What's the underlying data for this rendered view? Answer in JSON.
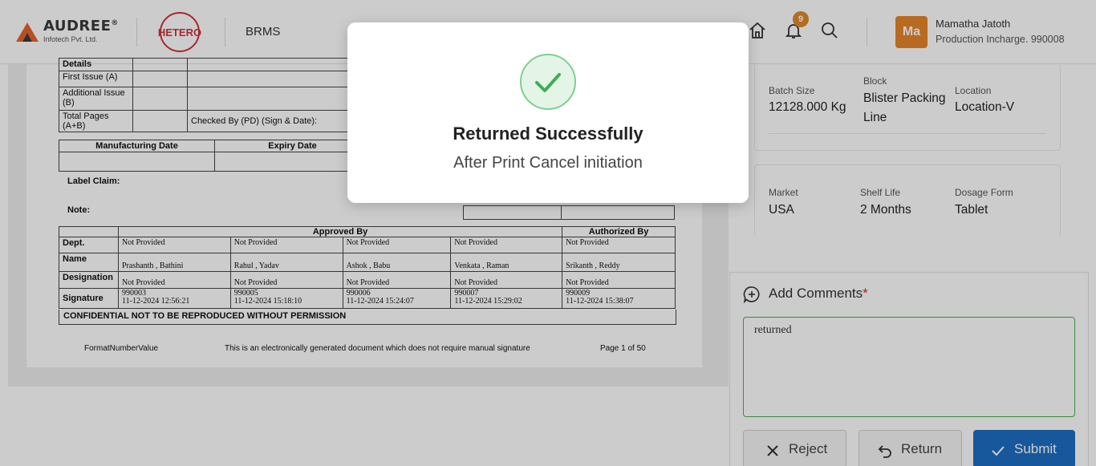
{
  "header": {
    "company_name": "AUDREE",
    "company_reg": "®",
    "company_sub": "Infotech Pvt. Ltd.",
    "partner_logo_text": "HETERO",
    "app_name": "BRMS",
    "notification_count": "9",
    "user": {
      "initials": "Ma",
      "name": "Mamatha Jatoth",
      "role": "Production Incharge. 990008"
    }
  },
  "document": {
    "issue_table": {
      "details": "Details",
      "first_issue": "First Issue (A)",
      "additional_issue": "Additional Issue (B)",
      "total_pages": "Total Pages (A+B)",
      "checked_by": "Checked By (PD) (Sign & Date):"
    },
    "dates": {
      "manufacturing": "Manufacturing Date",
      "expiry": "Expiry Date"
    },
    "label_claim": "Label Claim:",
    "note": "Note:",
    "signatures": {
      "approved_by": "Approved By",
      "authorized_by": "Authorized By",
      "labels": {
        "dept": "Dept.",
        "name": "Name",
        "designation": "Designation",
        "signature": "Signature"
      },
      "columns": [
        {
          "dept": "Not Provided",
          "name": "Prashanth , Bathini",
          "designation": "Not Provided",
          "sig_id": "990003",
          "sig_time": "11-12-2024 12:56:21"
        },
        {
          "dept": "Not Provided",
          "name": "Rahul , Yadav",
          "designation": "Not Provided",
          "sig_id": "990005",
          "sig_time": "11-12-2024 15:18:10"
        },
        {
          "dept": "Not Provided",
          "name": "Ashok , Babu",
          "designation": "Not Provided",
          "sig_id": "990006",
          "sig_time": "11-12-2024 15:24:07"
        },
        {
          "dept": "Not Provided",
          "name": "Venkata , Raman",
          "designation": "Not Provided",
          "sig_id": "990007",
          "sig_time": "11-12-2024 15:29:02"
        },
        {
          "dept": "Not Provided",
          "name": "Srikanth , Reddy",
          "designation": "Not Provided",
          "sig_id": "990009",
          "sig_time": "11-12-2024 15:38:07"
        }
      ]
    },
    "confidential": "CONFIDENTIAL NOT TO BE REPRODUCED WITHOUT PERMISSION",
    "footer": {
      "format": "FormatNumberValue",
      "disclaimer": "This is an electronically generated document which does not require manual signature",
      "page": "Page 1 of 50"
    }
  },
  "details_panel": {
    "batch_size": {
      "label": "Batch Size",
      "value": "12128.000 Kg"
    },
    "block": {
      "label": "Block",
      "value": "Blister Packing Line"
    },
    "location": {
      "label": "Location",
      "value": "Location-V"
    },
    "market": {
      "label": "Market",
      "value": "USA"
    },
    "shelf_life": {
      "label": "Shelf Life",
      "value": "2 Months"
    },
    "dosage_form": {
      "label": "Dosage Form",
      "value": "Tablet"
    }
  },
  "comments": {
    "title": "Add Comments",
    "required_mark": "*",
    "value": "returned"
  },
  "actions": {
    "reject": "Reject",
    "return": "Return",
    "submit": "Submit"
  },
  "modal": {
    "title": "Returned Successfully",
    "message": "After Print Cancel initiation"
  },
  "colors": {
    "accent_blue": "#1d6fc4",
    "avatar_orange": "#e8852a",
    "success_green": "#4caf50",
    "hetero_red": "#d0323a"
  }
}
